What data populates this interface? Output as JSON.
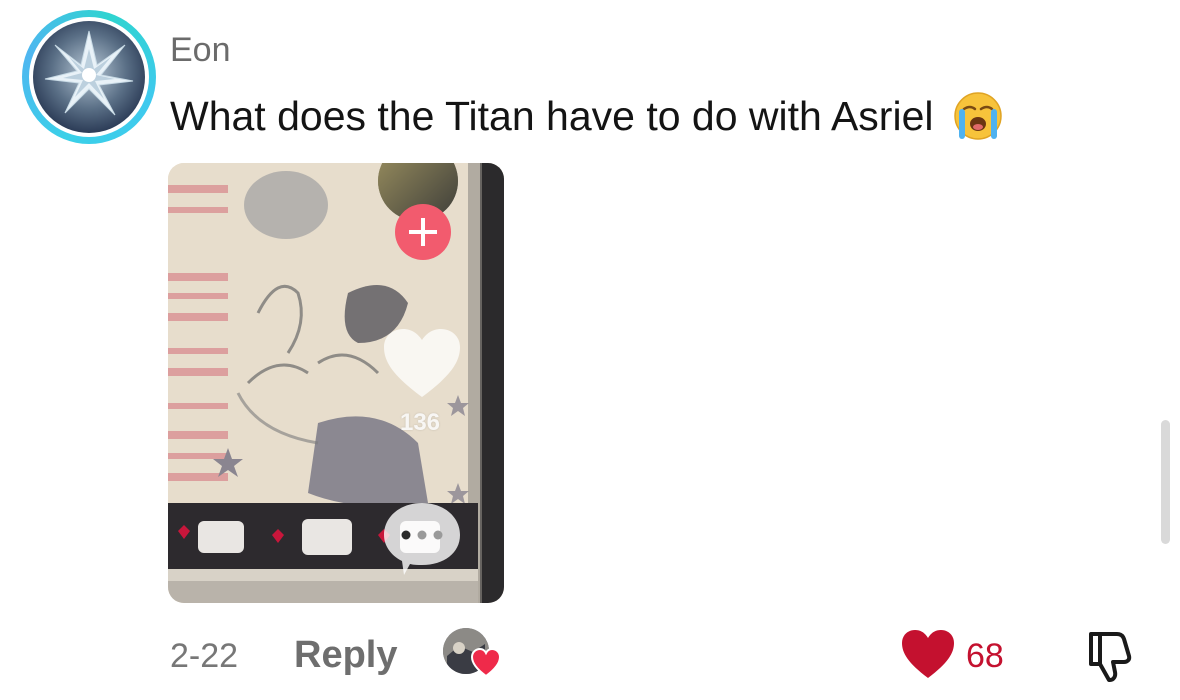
{
  "comment": {
    "username": "Eon",
    "text": "What does the Titan have to do with Asriel",
    "emoji": "loudly-crying-face",
    "date": "2-22",
    "reply_label": "Reply",
    "like_count": "68",
    "liked": true
  },
  "attachment": {
    "type": "video-thumbnail",
    "overlay_like_count": "136"
  },
  "colors": {
    "avatar_ring": "#3ad0e8",
    "like_red": "#c4112f",
    "text_primary": "#141414",
    "text_secondary": "#6b6b6b",
    "follow_plus": "#f25b6e"
  },
  "icons": {
    "like": "heart-filled-icon",
    "dislike": "thumbs-down-icon",
    "creator_liked": "creator-liked-heart-icon",
    "follow": "plus-icon",
    "overlay_like": "heart-icon",
    "overlay_comments": "comment-bubble-icon"
  }
}
